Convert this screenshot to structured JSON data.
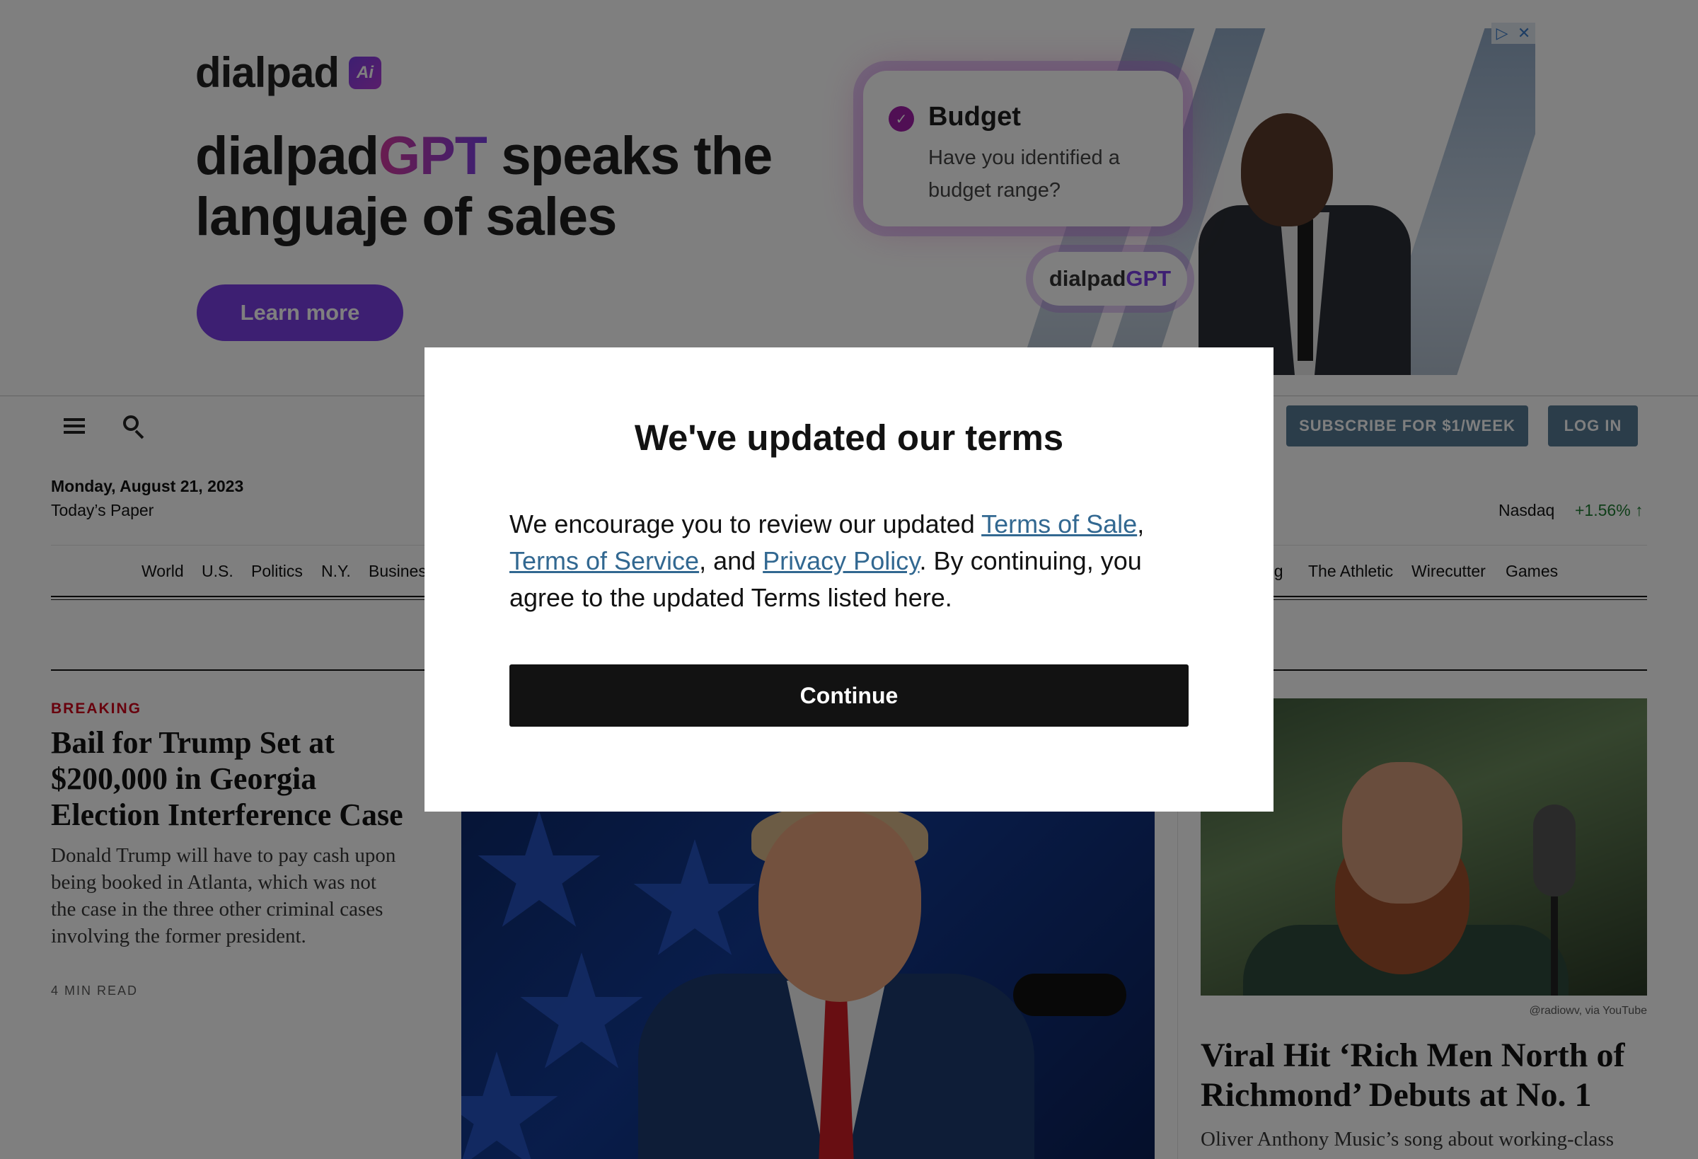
{
  "ad": {
    "brand": "dialpad",
    "brand_logo_glyph": "Ai",
    "headline_brand": "dialpad",
    "headline_gpt": "GPT",
    "headline_rest": " speaks the languaje of sales",
    "cta_label": "Learn more",
    "card_title": "Budget",
    "card_body": "Have you identified a budget range?",
    "pill_brand": "dialpad",
    "pill_gpt": "GPT",
    "adchoices_icon": "▷",
    "close_icon": "✕",
    "accent_color": "#7b3fe4"
  },
  "masthead": {
    "subscribe_label": "SUBSCRIBE FOR $1/WEEK",
    "login_label": "LOG IN",
    "date": "Monday, August 21, 2023",
    "todays_paper": "Today’s Paper",
    "ticker_name": "Nasdaq",
    "ticker_value": "+1.56% ↑"
  },
  "nav": {
    "items": [
      "World",
      "U.S.",
      "Politics",
      "N.Y.",
      "Busines",
      "ng",
      "The Athletic",
      "Wirecutter",
      "Games"
    ]
  },
  "lead": {
    "kicker": "BREAKING",
    "headline": "Bail for Trump Set at $200,000 in Georgia Election Interference Case",
    "summary": "Donald Trump will have to pay cash upon being booked in Atlanta, which was not the case in the three other criminal cases involving the former president.",
    "read_time": "4 MIN READ"
  },
  "right_story": {
    "credit": "@radiowv, via YouTube",
    "headline": "Viral Hit ‘Rich Men North of Richmond’ Debuts at No. 1",
    "summary": "Oliver Anthony Music’s song about working-class"
  },
  "modal": {
    "title": "We've updated our terms",
    "body_intro": "We encourage you to review our updated ",
    "link_sale": "Terms of Sale",
    "comma": ", ",
    "link_service": "Terms of Service",
    "and": ", and ",
    "link_privacy": "Privacy Policy",
    "body_outro": ". By continuing, you agree to the updated Terms listed here.",
    "continue_label": "Continue"
  }
}
